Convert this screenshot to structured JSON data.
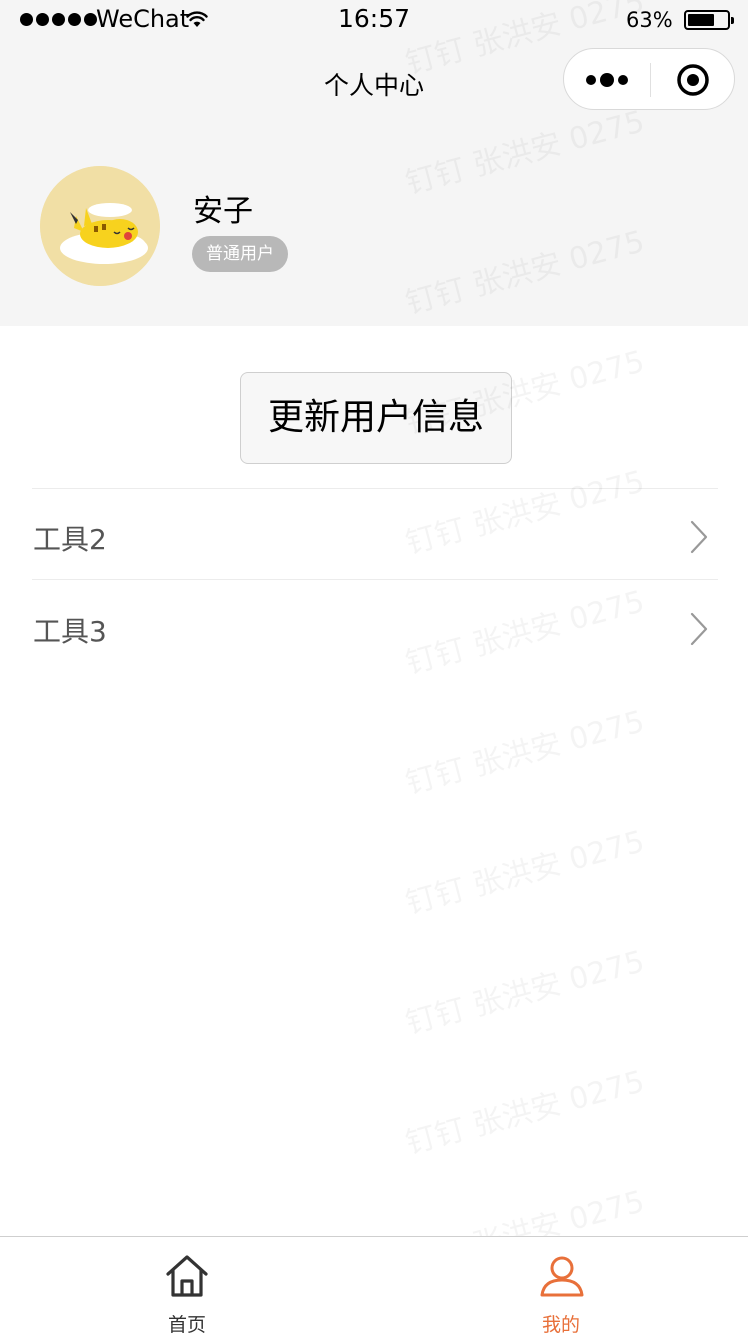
{
  "status_bar": {
    "carrier": "WeChat",
    "time": "16:57",
    "battery_percent": "63%",
    "battery_level": 0.63
  },
  "nav": {
    "title": "个人中心",
    "capsule_icons": [
      "more-dots-icon",
      "target-icon"
    ]
  },
  "profile": {
    "user_name": "安子",
    "badge": "普通用户",
    "avatar_icon": "pikachu-avatar"
  },
  "actions": {
    "update_button_label": "更新用户信息"
  },
  "list": {
    "items": [
      {
        "label": "工具2",
        "icon": "chevron-right-icon"
      },
      {
        "label": "工具3",
        "icon": "chevron-right-icon"
      }
    ]
  },
  "watermark": {
    "text": "钉钉 张洪安 0275"
  },
  "tab_bar": {
    "active_color": "#e8703a",
    "inactive_color": "#333333",
    "tabs": [
      {
        "label": "首页",
        "icon": "home-icon",
        "active": false
      },
      {
        "label": "我的",
        "icon": "user-icon",
        "active": true
      }
    ]
  }
}
